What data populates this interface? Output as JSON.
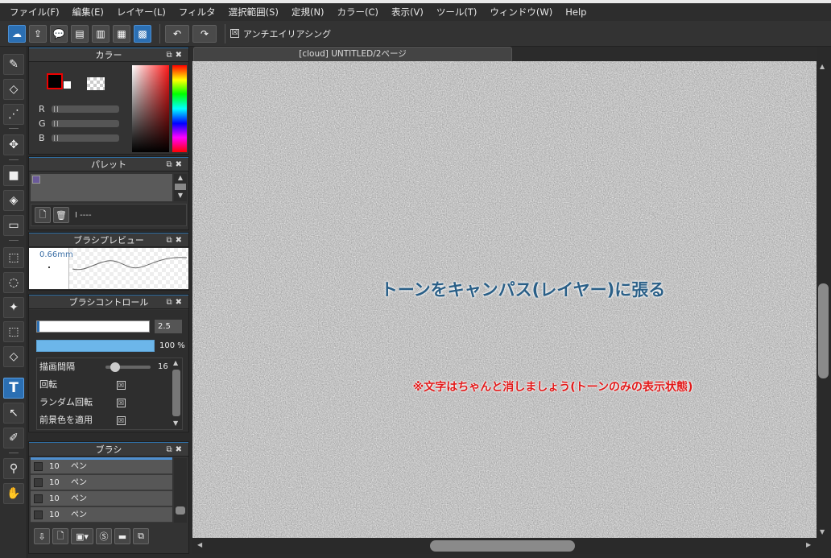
{
  "menu": [
    "ファイル(F)",
    "編集(E)",
    "レイヤー(L)",
    "フィルタ",
    "選択範囲(S)",
    "定規(N)",
    "カラー(C)",
    "表示(V)",
    "ツール(T)",
    "ウィンドウ(W)",
    "Help"
  ],
  "toolbar": {
    "antialias_label": "アンチエイリアシング",
    "antialias_checked": true,
    "check_glyph": "☒"
  },
  "tools": [
    "brush-icon",
    "eraser-icon",
    "dot-brush-icon",
    "move-icon",
    "rect-shape-icon",
    "fill-bucket-icon",
    "gradient-icon",
    "rect-select-icon",
    "lasso-icon",
    "magic-wand-icon",
    "select-pen-icon",
    "select-eraser-icon",
    "text-icon",
    "operation-icon",
    "eyedropper-icon",
    "hand-icon"
  ],
  "active_tool": "text-icon",
  "color_panel": {
    "title": "カラー",
    "labels": [
      "R",
      "G",
      "B"
    ],
    "foreground": "#000000",
    "background": "#ffffff"
  },
  "palette_panel": {
    "title": "パレット",
    "palette_name": "I ----",
    "swatch": "#6b5a9a"
  },
  "brush_preview_panel": {
    "title": "ブラシプレビュー",
    "size_label": "0.66mm"
  },
  "brush_control_panel": {
    "title": "ブラシコントロール",
    "size_value": "2.5",
    "opacity_value": "100 %",
    "rows": [
      {
        "label": "描画間隔",
        "value": "16"
      },
      {
        "label": "回転"
      },
      {
        "label": "ランダム回転"
      },
      {
        "label": "前景色を適用"
      }
    ]
  },
  "brush_panel": {
    "title": "ブラシ",
    "items": [
      {
        "size": "10",
        "name": "ペン"
      },
      {
        "size": "10",
        "name": "ペン"
      },
      {
        "size": "10",
        "name": "ペン"
      },
      {
        "size": "10",
        "name": "ペン"
      }
    ]
  },
  "document": {
    "tab_title": "[cloud] UNTITLED/2ページ",
    "title_text": "トーンをキャンパス(レイヤー)に張る",
    "note_text": "※文字はちゃんと消しましょう(トーンのみの表示状態)"
  },
  "colors": {
    "accent": "#2b6fb3",
    "title_text": "#2a5f87",
    "note_text": "#e21a1a"
  }
}
